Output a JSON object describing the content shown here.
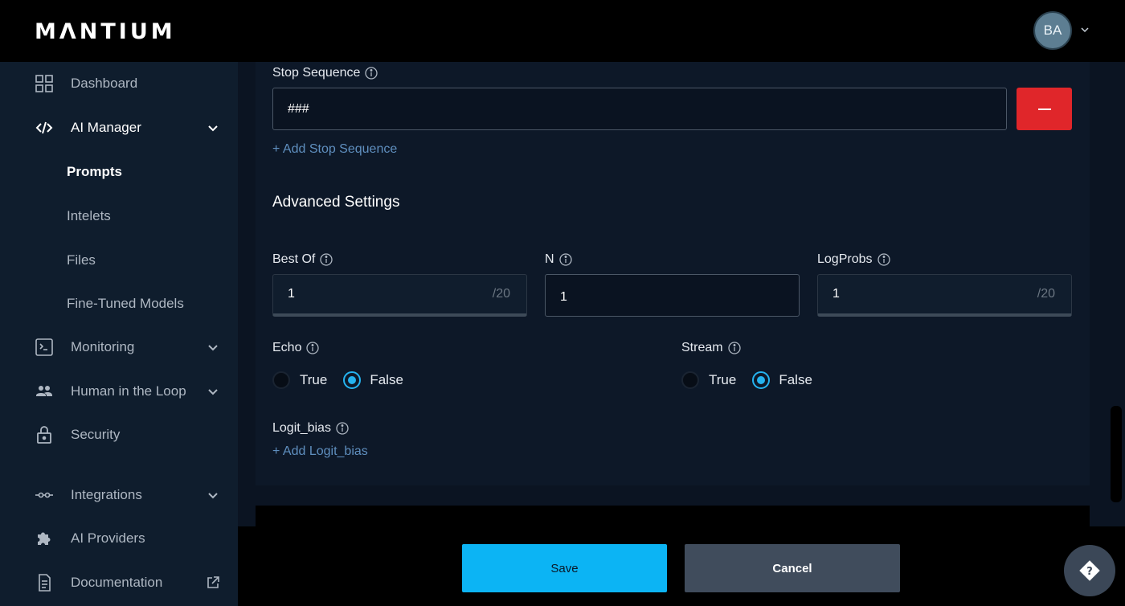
{
  "app": {
    "logo_text": "MΛNTIUM"
  },
  "user": {
    "initials": "BA"
  },
  "sidebar": {
    "items": [
      {
        "label": "Dashboard",
        "icon": "grid-icon"
      },
      {
        "label": "AI Manager",
        "icon": "code-icon",
        "expanded": true
      },
      {
        "label": "Monitoring",
        "icon": "terminal-icon"
      },
      {
        "label": "Human in the Loop",
        "icon": "people-icon"
      },
      {
        "label": "Security",
        "icon": "lock-icon"
      },
      {
        "label": "Integrations",
        "icon": "integrations-icon"
      },
      {
        "label": "AI Providers",
        "icon": "puzzle-icon"
      },
      {
        "label": "Documentation",
        "icon": "document-icon"
      }
    ],
    "ai_manager_sub": [
      {
        "label": "Prompts",
        "active": true
      },
      {
        "label": "Intelets"
      },
      {
        "label": "Files"
      },
      {
        "label": "Fine-Tuned Models"
      }
    ]
  },
  "form": {
    "stop_sequence": {
      "label": "Stop Sequence",
      "value": "###",
      "add_link": "+ Add Stop Sequence"
    },
    "advanced_title": "Advanced Settings",
    "best_of": {
      "label": "Best Of",
      "value": "1",
      "suffix": "/20"
    },
    "n": {
      "label": "N",
      "value": "1"
    },
    "logprobs": {
      "label": "LogProbs",
      "value": "1",
      "suffix": "/20"
    },
    "echo": {
      "label": "Echo",
      "true_label": "True",
      "false_label": "False",
      "selected": "False"
    },
    "stream": {
      "label": "Stream",
      "true_label": "True",
      "false_label": "False",
      "selected": "False"
    },
    "logit_bias": {
      "label": "Logit_bias",
      "add_link": "+ Add Logit_bias"
    }
  },
  "footer": {
    "save_label": "Save",
    "cancel_label": "Cancel"
  },
  "colors": {
    "accent": "#0cb4f4",
    "danger": "#e0262a",
    "sidebar_bg": "#0f1d2d",
    "main_bg": "#0b1422"
  }
}
